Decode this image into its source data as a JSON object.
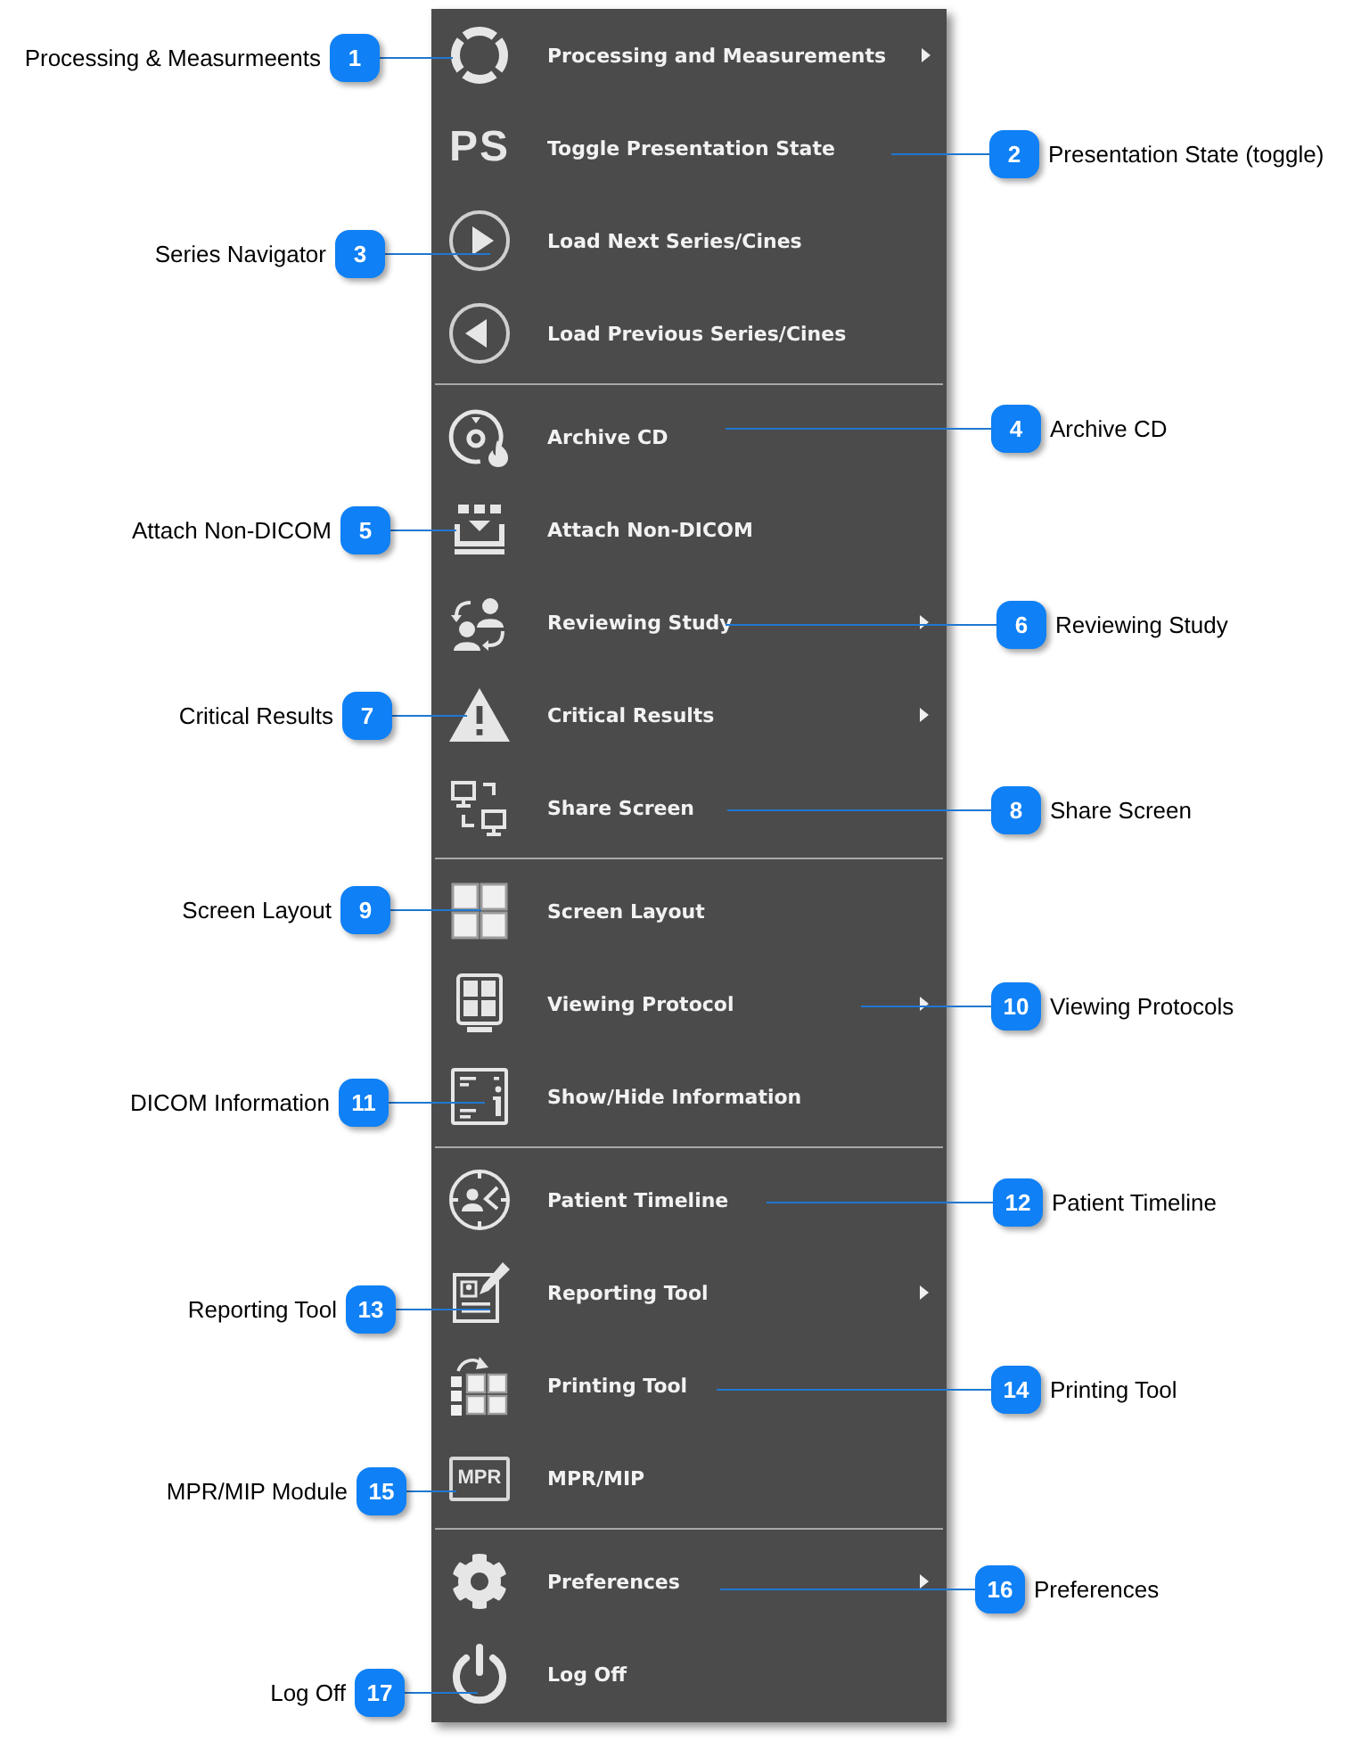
{
  "menu": {
    "sections": [
      {
        "items": [
          {
            "label": "Processing and Measurements",
            "submenu": true
          },
          {
            "label": "Toggle Presentation State",
            "submenu": false,
            "icon_text": "PS"
          },
          {
            "label": "Load Next Series/Cines",
            "submenu": false
          },
          {
            "label": "Load Previous Series/Cines",
            "submenu": false
          }
        ]
      },
      {
        "items": [
          {
            "label": "Archive CD",
            "submenu": false
          },
          {
            "label": "Attach Non-DICOM",
            "submenu": false
          },
          {
            "label": "Reviewing Study",
            "submenu": true
          },
          {
            "label": "Critical Results",
            "submenu": true
          },
          {
            "label": "Share Screen",
            "submenu": false
          }
        ]
      },
      {
        "items": [
          {
            "label": "Screen Layout",
            "submenu": false
          },
          {
            "label": "Viewing Protocol",
            "submenu": true
          },
          {
            "label": "Show/Hide Information",
            "submenu": false
          }
        ]
      },
      {
        "items": [
          {
            "label": "Patient Timeline",
            "submenu": false
          },
          {
            "label": "Reporting Tool",
            "submenu": true
          },
          {
            "label": "Printing Tool",
            "submenu": false
          },
          {
            "label": "MPR/MIP",
            "submenu": false,
            "icon_text": "MPR"
          }
        ]
      },
      {
        "items": [
          {
            "label": "Preferences",
            "submenu": true
          },
          {
            "label": "Log Off",
            "submenu": false
          }
        ]
      }
    ]
  },
  "callouts": [
    {
      "number": "1",
      "label": "Processing & Measurmeents"
    },
    {
      "number": "2",
      "label": "Presentation State (toggle)"
    },
    {
      "number": "3",
      "label": "Series Navigator"
    },
    {
      "number": "4",
      "label": "Archive CD"
    },
    {
      "number": "5",
      "label": "Attach Non-DICOM"
    },
    {
      "number": "6",
      "label": "Reviewing Study"
    },
    {
      "number": "7",
      "label": "Critical Results"
    },
    {
      "number": "8",
      "label": "Share Screen"
    },
    {
      "number": "9",
      "label": "Screen Layout"
    },
    {
      "number": "10",
      "label": "Viewing Protocols"
    },
    {
      "number": "11",
      "label": "DICOM Information"
    },
    {
      "number": "12",
      "label": "Patient Timeline"
    },
    {
      "number": "13",
      "label": "Reporting Tool"
    },
    {
      "number": "14",
      "label": "Printing Tool"
    },
    {
      "number": "15",
      "label": "MPR/MIP Module"
    },
    {
      "number": "16",
      "label": "Preferences"
    },
    {
      "number": "17",
      "label": "Log Off"
    }
  ]
}
